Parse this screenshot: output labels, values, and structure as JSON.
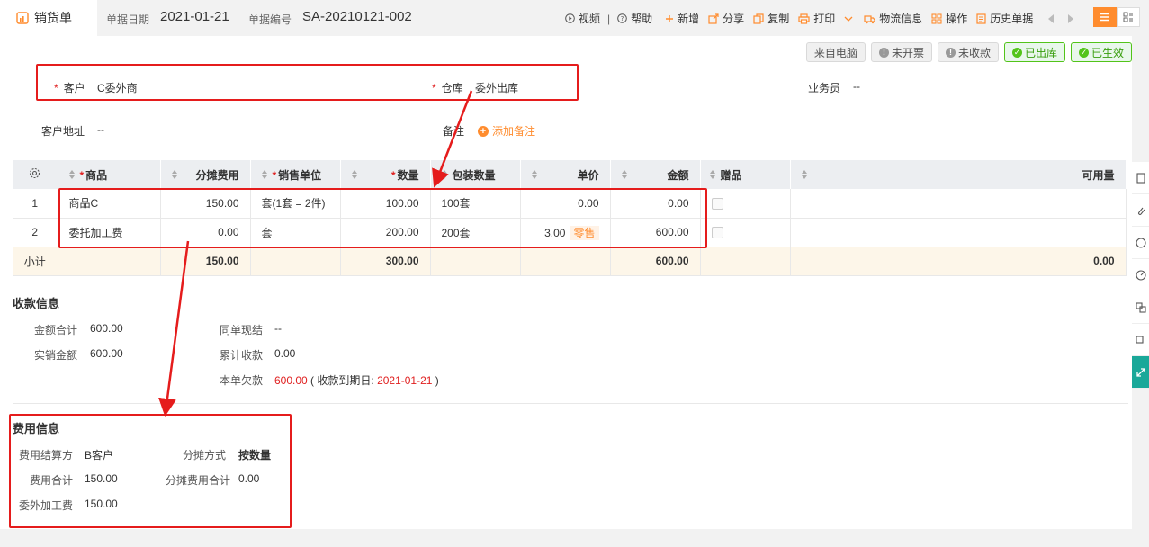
{
  "header": {
    "tab_title": "销货单",
    "date_label": "单据日期",
    "date_value": "2021-01-21",
    "no_label": "单据编号",
    "no_value": "SA-20210121-002"
  },
  "toolbar": {
    "video": "视频",
    "help": "帮助",
    "new": "新增",
    "share": "分享",
    "copy": "复制",
    "print": "打印",
    "logistics": "物流信息",
    "operate": "操作",
    "history": "历史单据",
    "separator": "|"
  },
  "badges": {
    "source": "来自电脑",
    "invoice": "未开票",
    "payment": "未收款",
    "stock": "已出库",
    "effective": "已生效"
  },
  "form": {
    "required_mark": "*",
    "customer_label": "客户",
    "customer_value": "C委外商",
    "warehouse_label": "仓库",
    "warehouse_value": "委外出库",
    "salesman_label": "业务员",
    "salesman_value": "--",
    "address_label": "客户地址",
    "address_value": "--",
    "remark_label": "备注",
    "add_remark": "添加备注"
  },
  "table": {
    "columns": {
      "product": "商品",
      "fee": "分摊费用",
      "unit": "销售单位",
      "qty": "数量",
      "pack": "包装数量",
      "price": "单价",
      "amount": "金额",
      "gift": "赠品",
      "available": "可用量"
    },
    "rows": [
      {
        "no": "1",
        "product": "商品C",
        "fee": "150.00",
        "unit": "套(1套 = 2件)",
        "qty": "100.00",
        "pack": "100套",
        "price": "0.00",
        "tag": "",
        "amount": "0.00"
      },
      {
        "no": "2",
        "product": "委托加工费",
        "fee": "0.00",
        "unit": "套",
        "qty": "200.00",
        "pack": "200套",
        "price": "3.00",
        "tag": "零售",
        "amount": "600.00"
      }
    ],
    "total": {
      "label": "小计",
      "fee": "150.00",
      "qty": "300.00",
      "amount": "600.00",
      "available": "0.00"
    }
  },
  "payment_info": {
    "title": "收款信息",
    "total_label": "金额合计",
    "total_value": "600.00",
    "actual_label": "实销金额",
    "actual_value": "600.00",
    "cash_label": "同单现结",
    "cash_value": "--",
    "received_label": "累计收款",
    "received_value": "0.00",
    "owed_label": "本单欠款",
    "owed_value": "600.00",
    "due_prefix": "( 收款到期日:",
    "due_date": "2021-01-21",
    "due_suffix": ")"
  },
  "fee_info": {
    "title": "费用信息",
    "settle_label": "费用结算方",
    "settle_value": "B客户",
    "method_label": "分摊方式",
    "method_value": "按数量",
    "total_label": "费用合计",
    "total_value": "150.00",
    "alloc_label": "分摊费用合计",
    "alloc_value": "0.00",
    "outsource_label": "委外加工费",
    "outsource_value": "150.00"
  },
  "colors": {
    "accent": "#ff8c2e",
    "annotation": "#e51c1c",
    "success": "#52c41a",
    "rail_active": "#1aa899"
  }
}
